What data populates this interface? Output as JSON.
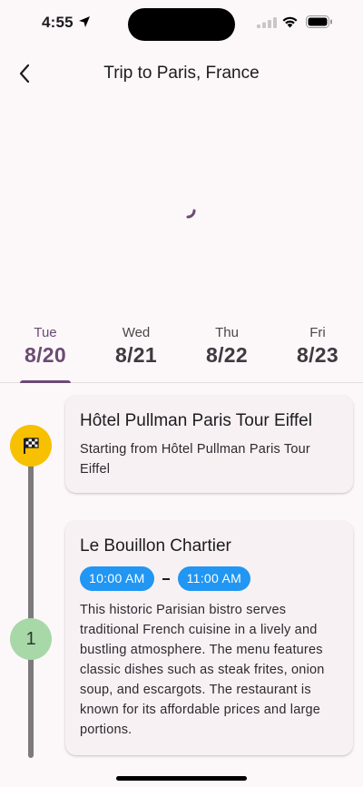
{
  "status_bar": {
    "time": "4:55"
  },
  "header": {
    "title": "Trip to Paris, France"
  },
  "tabs": [
    {
      "day": "Tue",
      "date": "8/20",
      "active": true
    },
    {
      "day": "Wed",
      "date": "8/21",
      "active": false
    },
    {
      "day": "Thu",
      "date": "8/22",
      "active": false
    },
    {
      "day": "Fri",
      "date": "8/23",
      "active": false
    }
  ],
  "stops": [
    {
      "marker": "",
      "marker_icon": "checkered-flag-icon",
      "marker_color": "#f7c000",
      "title": "Hôtel Pullman Paris Tour Eiffel",
      "subtitle": "Starting from Hôtel Pullman Paris Tour Eiffel"
    },
    {
      "marker": "1",
      "marker_color": "#a8d8a8",
      "title": "Le Bouillon Chartier",
      "start_time": "10:00 AM",
      "end_time": "11:00 AM",
      "description": "This historic Parisian bistro serves traditional French cuisine in a lively and bustling atmosphere. The menu features classic dishes such as steak frites, onion soup, and escargots. The restaurant is known for its affordable prices and large portions."
    }
  ],
  "colors": {
    "accent": "#6b4b74",
    "time_pill": "#2196f3"
  }
}
